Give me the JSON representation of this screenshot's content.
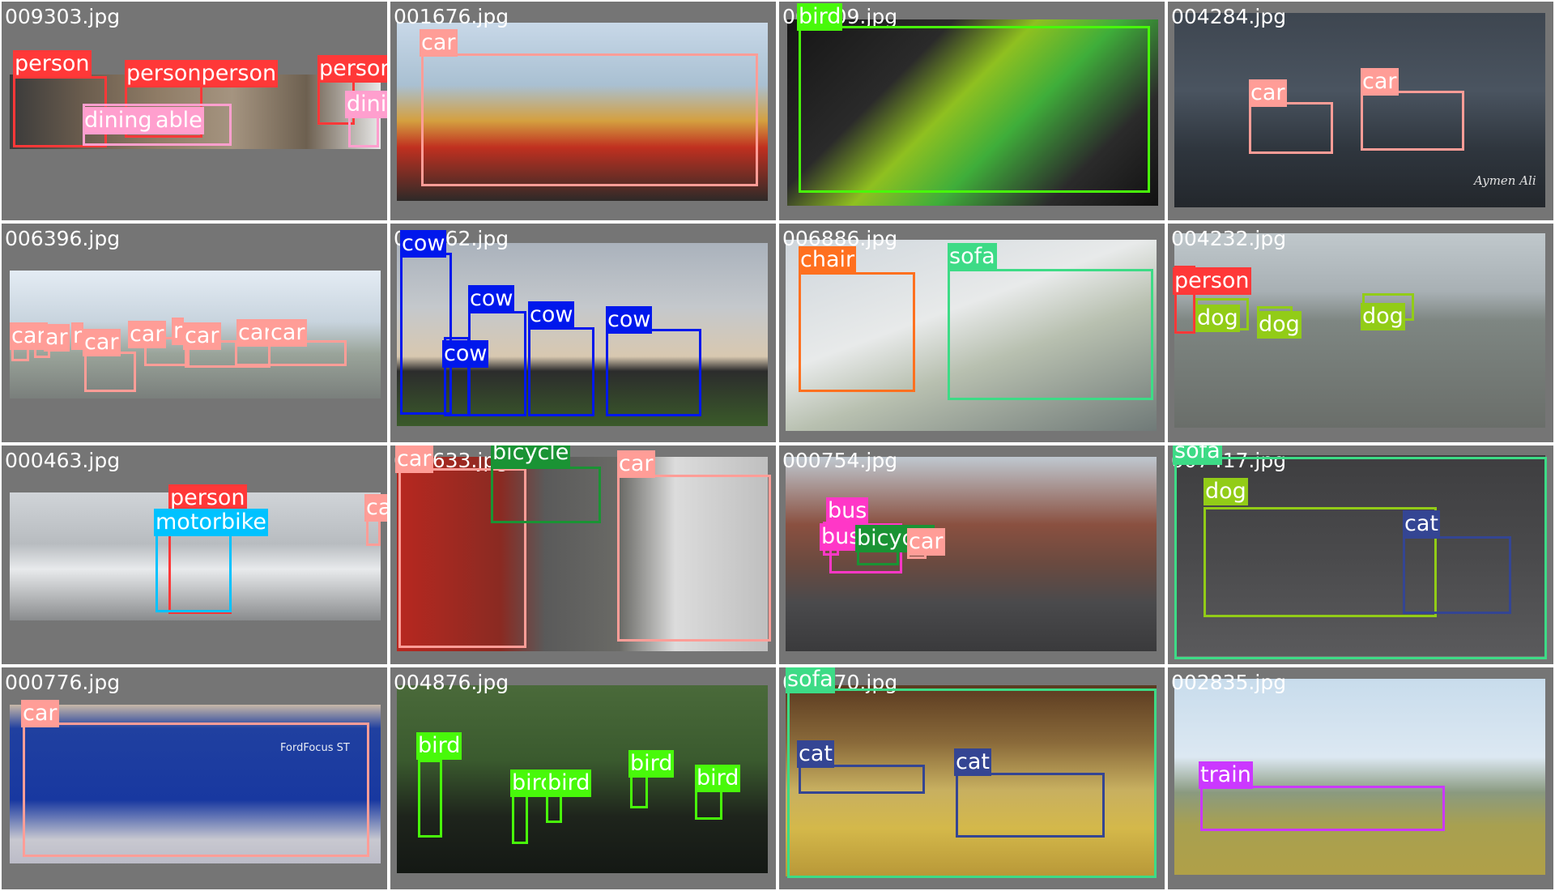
{
  "classes": {
    "person": "#ff3838",
    "car": "#ff9d97",
    "diningtable": "#ff9fce",
    "bird": "#48f90a",
    "cow": "#0018ec",
    "chair": "#ff701f",
    "sofa": "#3ddb86",
    "dog": "#92cc17",
    "motorbike": "#00c2ff",
    "bicycle": "#1a9334",
    "bus": "#ff37c7",
    "cat": "#344593",
    "train": "#cb38ff"
  },
  "tiles": [
    {
      "file": "009303.jpg",
      "labels": [
        "person",
        "personperson",
        "person",
        "dining",
        "able",
        "diningtable"
      ]
    },
    {
      "file": "001676.jpg",
      "labels": [
        "car"
      ]
    },
    {
      "file": "008209.jpg",
      "labels": [
        "bird"
      ]
    },
    {
      "file": "004284.jpg",
      "labels": [
        "car",
        "car"
      ],
      "signature": "Aymen Ali"
    },
    {
      "file": "006396.jpg",
      "labels": [
        "car",
        "ar",
        "r",
        "car",
        "car",
        "r",
        "car",
        "car",
        "car"
      ]
    },
    {
      "file": "002862.jpg",
      "labels": [
        "cow",
        "cow",
        "cow",
        "cow",
        "cow"
      ]
    },
    {
      "file": "006886.jpg",
      "labels": [
        "chair",
        "sofa"
      ]
    },
    {
      "file": "004232.jpg",
      "labels": [
        "person",
        "dog",
        "dog",
        "dog"
      ]
    },
    {
      "file": "000463.jpg",
      "labels": [
        "person",
        "motorbike",
        "car"
      ]
    },
    {
      "file": "002633.jpg",
      "labels": [
        "car",
        "bicycle",
        "car"
      ]
    },
    {
      "file": "000754.jpg",
      "labels": [
        "bus",
        "bus",
        "bicycle",
        "car"
      ]
    },
    {
      "file": "007417.jpg",
      "labels": [
        "sofa",
        "dog",
        "cat"
      ]
    },
    {
      "file": "000776.jpg",
      "labels": [
        "car"
      ],
      "sign": "FordFocus ST"
    },
    {
      "file": "004876.jpg",
      "labels": [
        "bird",
        "bird",
        "bird",
        "bird",
        "bird"
      ]
    },
    {
      "file": "002870.jpg",
      "labels": [
        "sofa",
        "cat",
        "cat"
      ]
    },
    {
      "file": "002835.jpg",
      "labels": [
        "train"
      ]
    }
  ]
}
